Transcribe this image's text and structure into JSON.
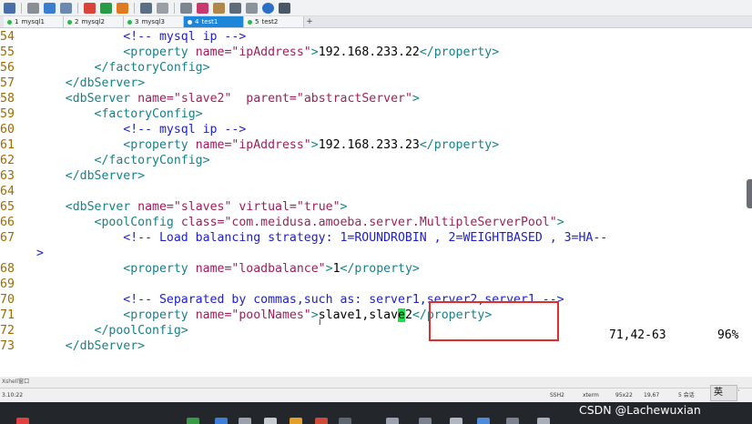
{
  "tabs": [
    {
      "num": "1",
      "name": "mysql1",
      "active": false
    },
    {
      "num": "2",
      "name": "mysql2",
      "active": false
    },
    {
      "num": "3",
      "name": "mysql3",
      "active": false
    },
    {
      "num": "4",
      "name": "test1",
      "active": true
    },
    {
      "num": "5",
      "name": "test2",
      "active": false
    }
  ],
  "tab_add": "+",
  "editor": {
    "lines": [
      {
        "ln": "54",
        "indent": "            ",
        "parts": [
          [
            "c",
            "<!-- mysql ip -->"
          ]
        ]
      },
      {
        "ln": "55",
        "indent": "            ",
        "parts": [
          [
            "t",
            "<property "
          ],
          [
            "a",
            "name="
          ],
          [
            "s",
            "\"ipAddress\""
          ],
          [
            "t",
            ">"
          ],
          [
            "x",
            "192.168.233.22"
          ],
          [
            "t",
            "</property>"
          ]
        ]
      },
      {
        "ln": "56",
        "indent": "        ",
        "parts": [
          [
            "t",
            "</factoryConfig>"
          ]
        ]
      },
      {
        "ln": "57",
        "indent": "    ",
        "parts": [
          [
            "t",
            "</dbServer>"
          ]
        ]
      },
      {
        "ln": "58",
        "indent": "    ",
        "parts": [
          [
            "t",
            "<dbServer "
          ],
          [
            "a",
            "name="
          ],
          [
            "s",
            "\"slave2\""
          ],
          [
            "t",
            "  "
          ],
          [
            "a",
            "parent="
          ],
          [
            "s",
            "\"abstractServer\""
          ],
          [
            "t",
            ">"
          ]
        ]
      },
      {
        "ln": "59",
        "indent": "        ",
        "parts": [
          [
            "t",
            "<factoryConfig>"
          ]
        ]
      },
      {
        "ln": "60",
        "indent": "            ",
        "parts": [
          [
            "c",
            "<!-- mysql ip -->"
          ]
        ]
      },
      {
        "ln": "61",
        "indent": "            ",
        "parts": [
          [
            "t",
            "<property "
          ],
          [
            "a",
            "name="
          ],
          [
            "s",
            "\"ipAddress\""
          ],
          [
            "t",
            ">"
          ],
          [
            "x",
            "192.168.233.23"
          ],
          [
            "t",
            "</property>"
          ]
        ]
      },
      {
        "ln": "62",
        "indent": "        ",
        "parts": [
          [
            "t",
            "</factoryConfig>"
          ]
        ]
      },
      {
        "ln": "63",
        "indent": "    ",
        "parts": [
          [
            "t",
            "</dbServer>"
          ]
        ]
      },
      {
        "ln": "64",
        "indent": "",
        "parts": []
      },
      {
        "ln": "65",
        "indent": "    ",
        "parts": [
          [
            "t",
            "<dbServer "
          ],
          [
            "a",
            "name="
          ],
          [
            "s",
            "\"slaves\""
          ],
          [
            "t",
            " "
          ],
          [
            "a",
            "virtual="
          ],
          [
            "s",
            "\"true\""
          ],
          [
            "t",
            ">"
          ]
        ]
      },
      {
        "ln": "66",
        "indent": "        ",
        "parts": [
          [
            "t",
            "<poolConfig "
          ],
          [
            "a",
            "class="
          ],
          [
            "s",
            "\"com.meidusa.amoeba.server.MultipleServerPool\""
          ],
          [
            "t",
            ">"
          ]
        ]
      },
      {
        "ln": "67",
        "indent": "            ",
        "parts": [
          [
            "c",
            "<!-- Load balancing strategy: 1=ROUNDROBIN , 2=WEIGHTBASED , 3=HA--"
          ]
        ]
      },
      {
        "ln": "",
        "indent": "",
        "parts": [
          [
            "c",
            ">"
          ]
        ]
      },
      {
        "ln": "68",
        "indent": "            ",
        "parts": [
          [
            "t",
            "<property "
          ],
          [
            "a",
            "name="
          ],
          [
            "s",
            "\"loadbalance\""
          ],
          [
            "t",
            ">"
          ],
          [
            "x",
            "1"
          ],
          [
            "t",
            "</property>"
          ]
        ]
      },
      {
        "ln": "69",
        "indent": "",
        "parts": []
      },
      {
        "ln": "70",
        "indent": "            ",
        "parts": [
          [
            "c",
            "<!-- Separated by commas,such as: server1,server2,server1 -->"
          ]
        ]
      },
      {
        "ln": "71",
        "indent": "            ",
        "parts": [
          [
            "t",
            "<property "
          ],
          [
            "a",
            "name="
          ],
          [
            "s",
            "\"poolNames\""
          ],
          [
            "t",
            ">"
          ],
          [
            "x",
            "slave1,slav"
          ],
          [
            "cursor",
            "e"
          ],
          [
            "x",
            "2"
          ],
          [
            "t",
            "</property>"
          ]
        ]
      },
      {
        "ln": "72",
        "indent": "        ",
        "parts": [
          [
            "t",
            "</poolConfig>"
          ]
        ]
      },
      {
        "ln": "73",
        "indent": "    ",
        "parts": [
          [
            "t",
            "</dbServer>"
          ]
        ]
      }
    ],
    "cursor_pos": "71,42-63",
    "scroll_pct": "96%",
    "mouse_cursor": "I"
  },
  "xshell_label": "Xshell窗口",
  "statusbar": {
    "left": "3.10:22",
    "protocol": "SSH2",
    "term": "xterm",
    "size": "95x22",
    "pos": "19,67",
    "sessions": "5 会话"
  },
  "ime": "英",
  "ime_dot": "·",
  "watermark": "CSDN @Lachewuxian",
  "colors": {
    "tab_active": "#1d86d8",
    "highlight_box": "#e32b2b",
    "cursor_bg": "#1fe04a",
    "comment": "#2020c8",
    "tag": "#17808a",
    "attr": "#a01a5a"
  }
}
